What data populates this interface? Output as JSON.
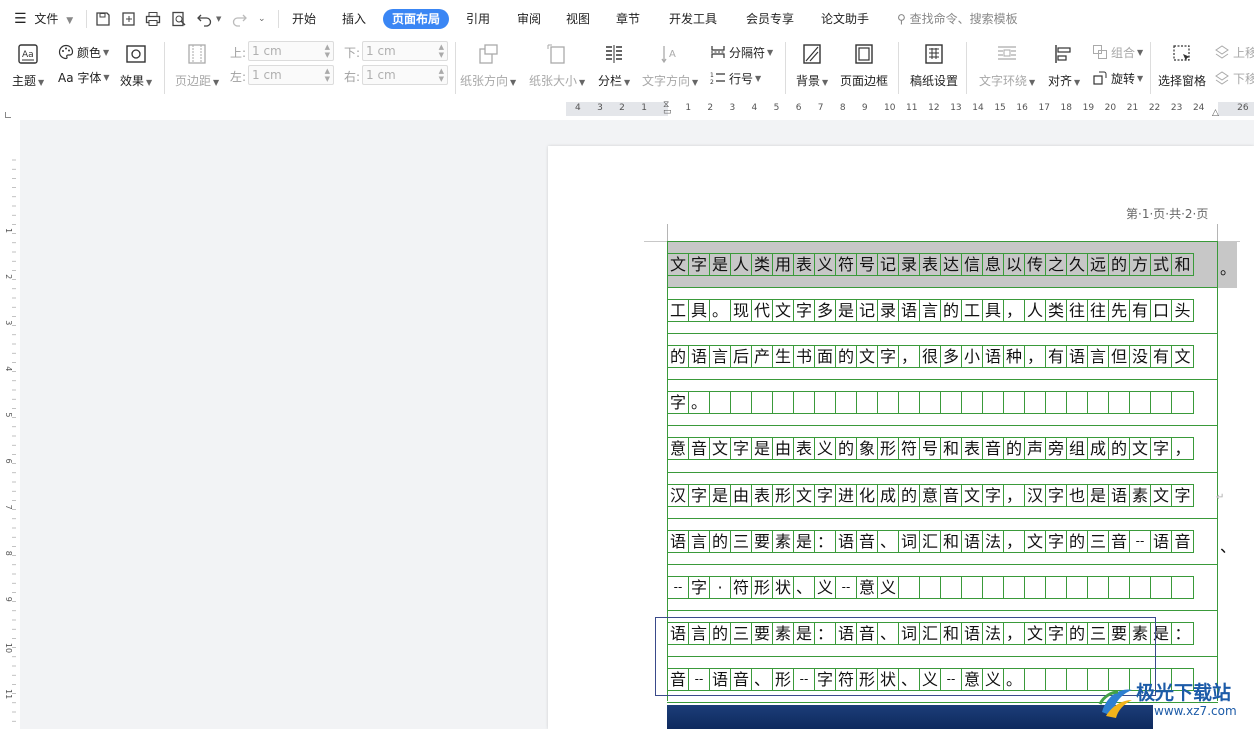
{
  "menu": {
    "file": "文件",
    "tabs": [
      "开始",
      "插入",
      "页面布局",
      "引用",
      "审阅",
      "视图",
      "章节",
      "开发工具",
      "会员专享",
      "论文助手"
    ],
    "active_tab": "页面布局",
    "search_placeholder": "查找命令、搜索模板"
  },
  "ribbon": {
    "theme": "主题",
    "color": "颜色",
    "font": "Aa 字体",
    "effect": "效果",
    "margin": "页边距",
    "margins": {
      "top_label": "上:",
      "top_value": "1 cm",
      "bottom_label": "下:",
      "bottom_value": "1 cm",
      "left_label": "左:",
      "left_value": "1 cm",
      "right_label": "右:",
      "right_value": "1 cm"
    },
    "orientation": "纸张方向",
    "size": "纸张大小",
    "columns": "分栏",
    "text_direction": "文字方向",
    "break": "分隔符",
    "line_number": "行号",
    "background": "背景",
    "page_border": "页面边框",
    "grid_paper": "稿纸设置",
    "text_wrap": "文字环绕",
    "align": "对齐",
    "group": "组合",
    "rotate": "旋转",
    "selection_pane": "选择窗格",
    "bring_forward": "上移",
    "send_backward": "下移"
  },
  "ruler": {
    "h_ticks": [
      "4",
      "3",
      "2",
      "1",
      "",
      "1",
      "2",
      "3",
      "4",
      "5",
      "6",
      "7",
      "8",
      "9",
      "10",
      "11",
      "12",
      "13",
      "14",
      "15",
      "16",
      "17",
      "18",
      "19",
      "20",
      "21",
      "22",
      "23",
      "24",
      "",
      "26"
    ],
    "v_ticks": [
      "1",
      "2",
      "3",
      "4",
      "5",
      "6",
      "7",
      "8",
      "9",
      "10",
      "11"
    ]
  },
  "document": {
    "header": "第·1·页·共·2·页",
    "rows": [
      "文字是人类用表义符号记录表达信息以传之久远的方式和",
      "工具。现代文字多是记录语言的工具，人类往往先有口头",
      "的语言后产生书面的文字，很多小语种，有语言但没有文",
      "字。",
      "意音文字是由表义的象形符号和表音的声旁组成的文字，",
      "汉字是由表形文字进化成的意音文字，汉字也是语素文字",
      "语言的三要素是：语音、词汇和语法，文字的三音--语音",
      "--字·符形状、义--意义",
      "语言的三要素是：语音、词汇和语法，文字的三要素是：",
      "音--语音、形--字符形状、义--意义。"
    ],
    "overflow_chars": [
      "。",
      "、"
    ]
  },
  "watermark": {
    "name": "极光下载站",
    "url": "www.xz7.com"
  }
}
